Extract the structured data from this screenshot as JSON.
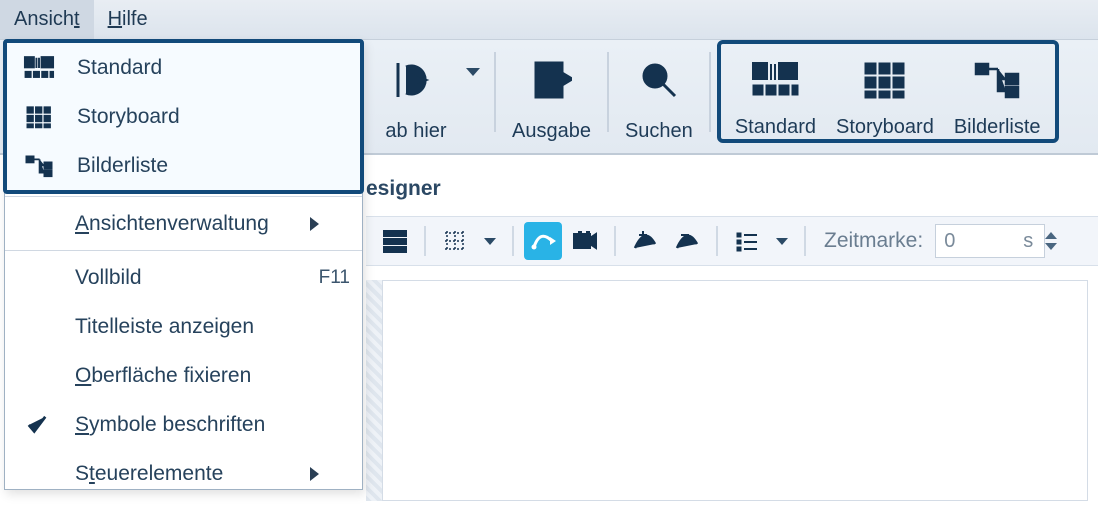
{
  "menu": {
    "view": "Ansicht",
    "help": "Hilfe"
  },
  "toolbar": {
    "from_here": "ab hier",
    "output": "Ausgabe",
    "search": "Suchen",
    "standard": "Standard",
    "storyboard": "Storyboard",
    "imagelist": "Bilderliste"
  },
  "dropdown": {
    "standard": "Standard",
    "storyboard": "Storyboard",
    "imagelist": "Bilderliste",
    "view_mgmt": "Ansichtenverwaltung",
    "fullscreen": "Vollbild",
    "fullscreen_key": "F11",
    "titlebar": "Titelleiste anzeigen",
    "lock_ui": "Oberfläche fixieren",
    "label_icons": "Symbole beschriften",
    "controls": "Steuerelemente"
  },
  "tab": {
    "designer": "esigner"
  },
  "timeline": {
    "label": "Zeitmarke:",
    "value": "0",
    "unit": "s"
  }
}
